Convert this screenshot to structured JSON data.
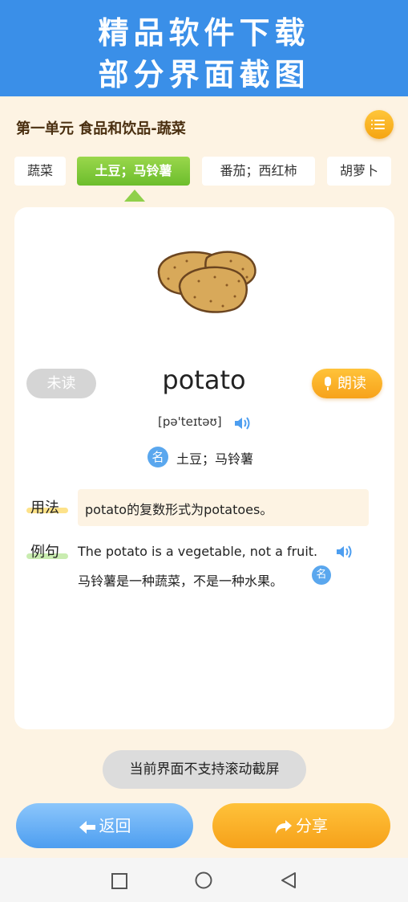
{
  "banner": {
    "line1": "精品软件下载",
    "line2": "部分界面截图"
  },
  "header": {
    "title": "第一单元 食品和饮品-蔬菜",
    "menu_icon": "list-icon"
  },
  "tabs": [
    {
      "label": "蔬菜",
      "active": false
    },
    {
      "label": "土豆；马铃薯",
      "active": true
    },
    {
      "label": "番茄；西红柿",
      "active": false
    },
    {
      "label": "胡萝卜",
      "active": false
    }
  ],
  "word": {
    "unread_label": "未读",
    "text": "potato",
    "read_label": "朗读",
    "phonetic": "[pə'teɪtəʊ]",
    "pos": "名",
    "meaning": "土豆；马铃薯"
  },
  "usage": {
    "label": "用法",
    "text": "potato的复数形式为potatoes。"
  },
  "example": {
    "label": "例句",
    "en": "The potato is a vegetable, not a fruit.",
    "cn": "马铃薯是一种蔬菜，不是一种水果。",
    "pos": "名"
  },
  "toast": "当前界面不支持滚动截屏",
  "footer": {
    "back_label": "返回",
    "share_label": "分享"
  },
  "colors": {
    "accent_blue": "#3a8fe8",
    "accent_orange": "#f7a21a",
    "accent_green": "#6cbd2c",
    "background": "#fdf3e3"
  }
}
